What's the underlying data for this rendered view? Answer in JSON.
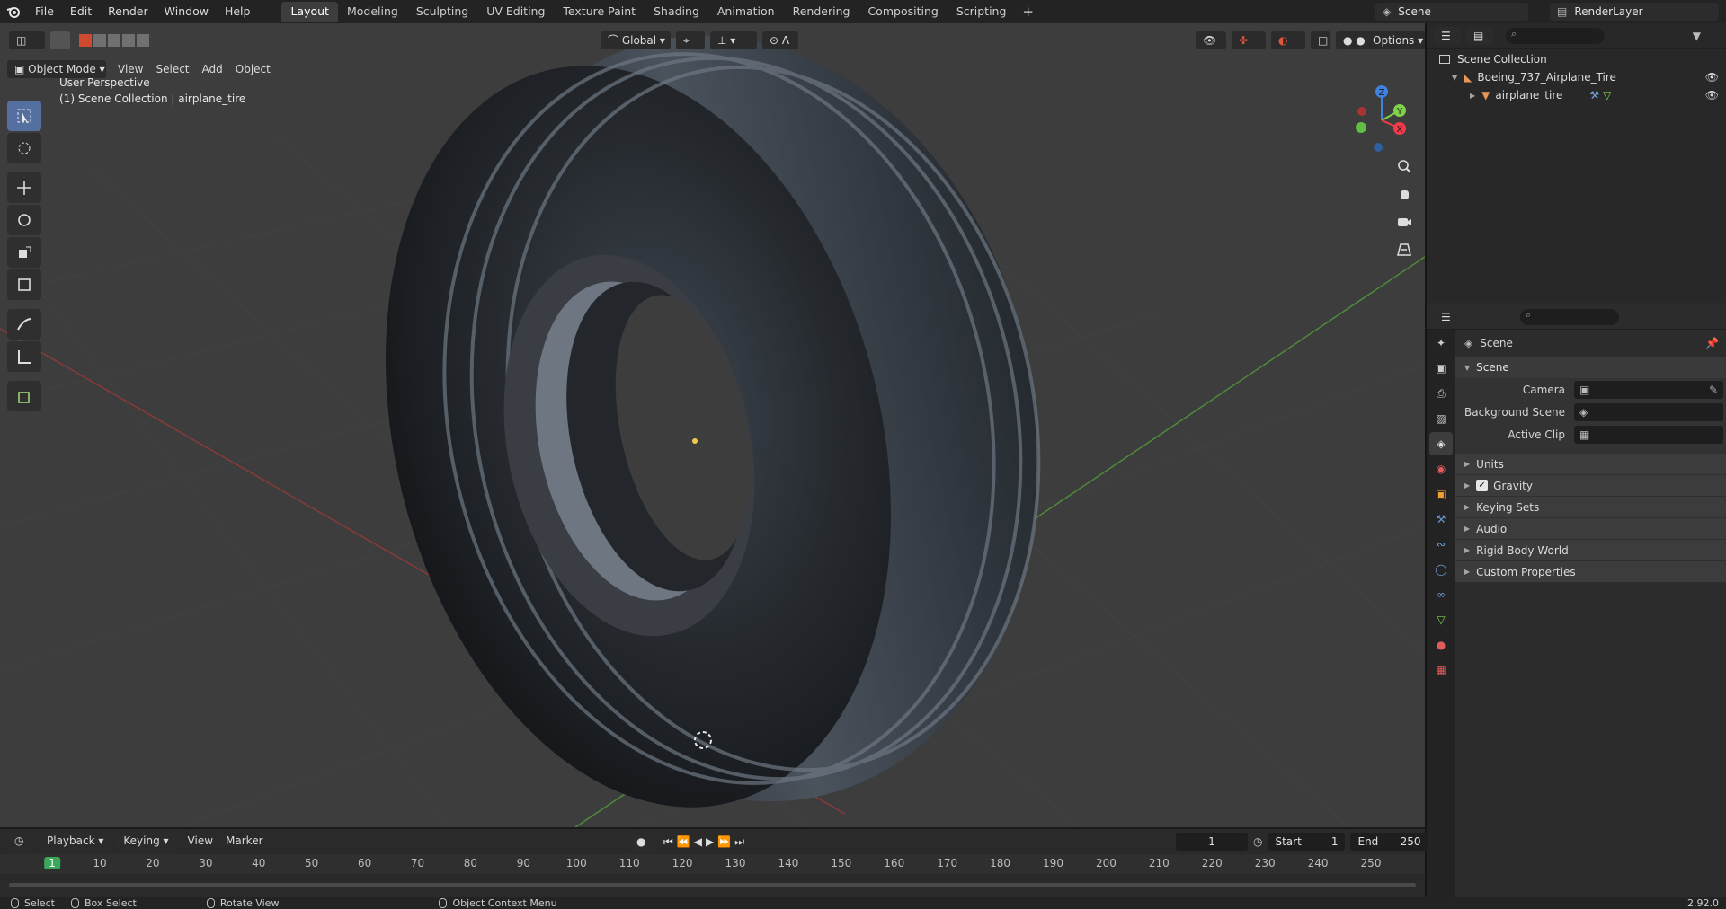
{
  "menu": {
    "items": [
      "File",
      "Edit",
      "Render",
      "Window",
      "Help"
    ]
  },
  "workspaces": {
    "tabs": [
      "Layout",
      "Modeling",
      "Sculpting",
      "UV Editing",
      "Texture Paint",
      "Shading",
      "Animation",
      "Rendering",
      "Compositing",
      "Scripting"
    ],
    "active": "Layout",
    "add_label": "+"
  },
  "topright": {
    "scene": "Scene",
    "render_layer": "RenderLayer"
  },
  "viewport": {
    "mode": "Object Mode",
    "menus": [
      "View",
      "Select",
      "Add",
      "Object"
    ],
    "orientation": "Global",
    "options_label": "Options",
    "perspective_label": "User Perspective",
    "collection_info": "(1) Scene Collection | airplane_tire",
    "tools": [
      "select-box-icon",
      "cursor-icon",
      "move-icon",
      "rotate-icon",
      "scale-icon",
      "transform-icon",
      "annotate-icon",
      "measure-icon",
      "add-cube-icon"
    ],
    "gizmo_axes": [
      "Z",
      "Y",
      "X"
    ]
  },
  "outliner": {
    "root": "Scene Collection",
    "items": [
      {
        "label": "Boeing_737_Airplane_Tire",
        "type": "collection"
      },
      {
        "label": "airplane_tire",
        "type": "mesh"
      }
    ]
  },
  "properties": {
    "context": "Scene",
    "panel_title": "Scene",
    "fields": {
      "camera_label": "Camera",
      "background_scene_label": "Background Scene",
      "active_clip_label": "Active Clip"
    },
    "subpanels": [
      "Units",
      "Gravity",
      "Keying Sets",
      "Audio",
      "Rigid Body World",
      "Custom Properties"
    ],
    "gravity_checked": true,
    "tab_icons": [
      "tool-icon",
      "render-icon",
      "output-icon",
      "view-layer-icon",
      "scene-icon",
      "world-icon",
      "object-icon",
      "modifier-icon",
      "particles-icon",
      "physics-icon",
      "constraints-icon",
      "data-icon",
      "material-icon",
      "texture-icon"
    ]
  },
  "timeline": {
    "menus": [
      "Playback",
      "Keying",
      "View",
      "Marker"
    ],
    "current_frame": "1",
    "start_label": "Start",
    "start": "1",
    "end_label": "End",
    "end": "250",
    "ruler_labels": [
      "1",
      "10",
      "20",
      "30",
      "40",
      "50",
      "60",
      "70",
      "80",
      "90",
      "100",
      "110",
      "120",
      "130",
      "140",
      "150",
      "160",
      "170",
      "180",
      "190",
      "200",
      "210",
      "220",
      "230",
      "240",
      "250"
    ]
  },
  "statusbar": {
    "items": [
      "Select",
      "Box Select",
      "Rotate View",
      "Object Context Menu"
    ],
    "version": "2.92.0"
  },
  "colors": {
    "accent": "#4772b3",
    "active_tool": "#546fa0",
    "axis_x": "#f03c4a",
    "axis_y": "#7fd24a",
    "axis_z": "#3f82e0",
    "frame_marker": "#3aa85a"
  }
}
